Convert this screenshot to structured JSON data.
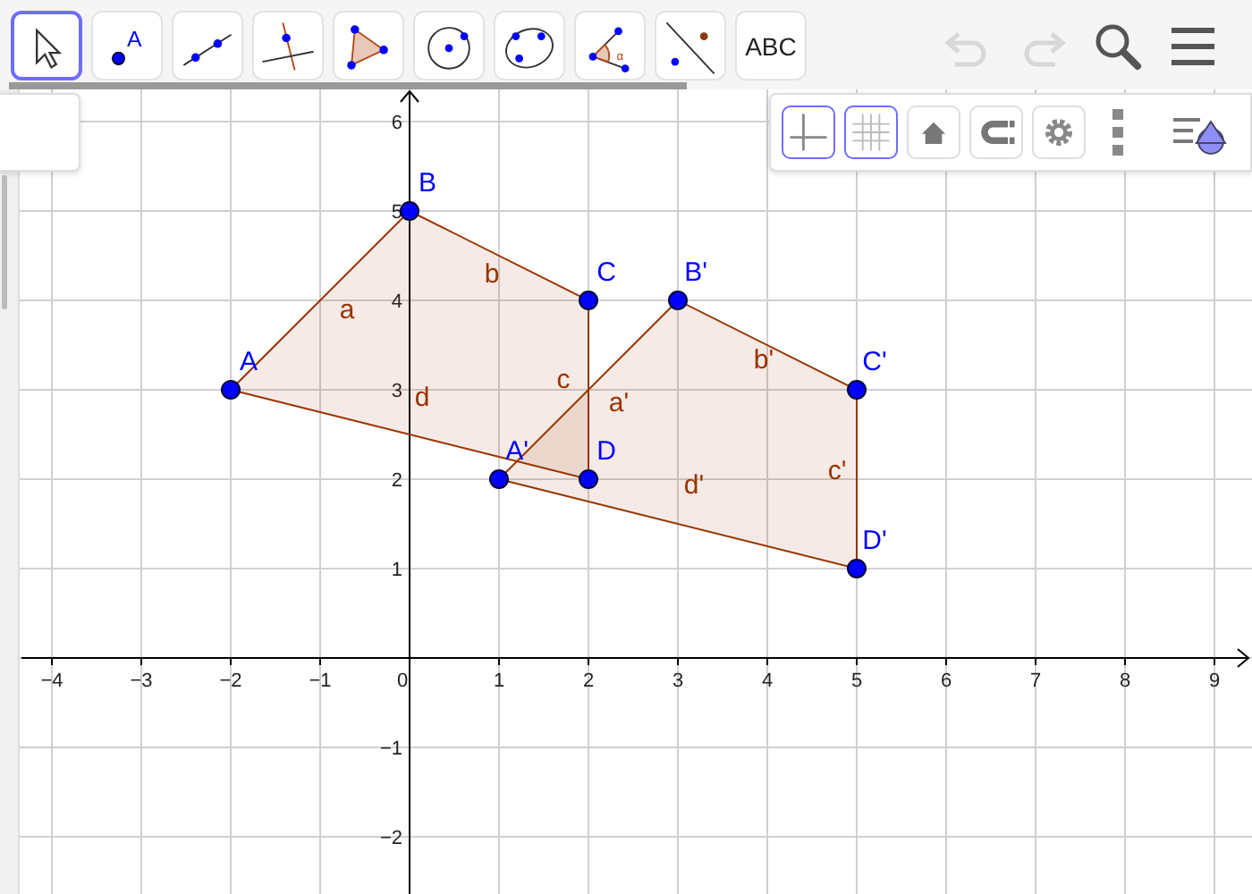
{
  "toolbar": {
    "tools": [
      {
        "kind": "move",
        "selected": true
      },
      {
        "kind": "point",
        "label": "A",
        "selected": false
      },
      {
        "kind": "line",
        "selected": false
      },
      {
        "kind": "perpendicular",
        "selected": false
      },
      {
        "kind": "polygon",
        "selected": false
      },
      {
        "kind": "circle",
        "selected": false
      },
      {
        "kind": "conic",
        "selected": false
      },
      {
        "kind": "angle",
        "label": "α",
        "selected": false
      },
      {
        "kind": "reflect",
        "selected": false
      },
      {
        "kind": "text",
        "label": "ABC",
        "selected": false
      }
    ],
    "actions": [
      {
        "kind": "undo",
        "disabled": true
      },
      {
        "kind": "redo",
        "disabled": true
      },
      {
        "kind": "search",
        "disabled": false
      },
      {
        "kind": "menu",
        "disabled": false
      }
    ]
  },
  "style_bar": {
    "buttons": [
      {
        "kind": "axes",
        "selected": true
      },
      {
        "kind": "grid",
        "selected": true
      },
      {
        "kind": "home"
      },
      {
        "kind": "magnet"
      },
      {
        "kind": "settings"
      },
      {
        "kind": "more"
      },
      {
        "kind": "panel"
      }
    ]
  },
  "graphics": {
    "chart_data": {
      "type": "area",
      "grid": true,
      "xlim": [
        -4.58,
        9.42
      ],
      "ylim": [
        -2.64,
        6.36
      ],
      "xticks": [
        {
          "value": -4,
          "label": "−4"
        },
        {
          "value": -3,
          "label": "−3"
        },
        {
          "value": -2,
          "label": "−2"
        },
        {
          "value": -1,
          "label": "−1"
        },
        {
          "value": 0,
          "label": "0"
        },
        {
          "value": 1,
          "label": "1"
        },
        {
          "value": 2,
          "label": "2"
        },
        {
          "value": 3,
          "label": "3"
        },
        {
          "value": 4,
          "label": "4"
        },
        {
          "value": 5,
          "label": "5"
        },
        {
          "value": 6,
          "label": "6"
        },
        {
          "value": 7,
          "label": "7"
        },
        {
          "value": 8,
          "label": "8"
        },
        {
          "value": 9,
          "label": "9"
        }
      ],
      "yticks": [
        {
          "value": -2,
          "label": "−2"
        },
        {
          "value": -1,
          "label": "−1"
        },
        {
          "value": 1,
          "label": "1"
        },
        {
          "value": 2,
          "label": "2"
        },
        {
          "value": 3,
          "label": "3"
        },
        {
          "value": 4,
          "label": "4"
        },
        {
          "value": 5,
          "label": "5"
        },
        {
          "value": 6,
          "label": "6"
        }
      ],
      "series": [
        {
          "color": "#993300",
          "x": [
            -2,
            0,
            2,
            2,
            -2
          ],
          "values": [
            3,
            5,
            4,
            2,
            3
          ]
        },
        {
          "color": "#993300",
          "x": [
            1,
            3,
            5,
            5,
            1
          ],
          "values": [
            2,
            4,
            3,
            1,
            2
          ]
        }
      ],
      "annotations": [
        {
          "text": "A",
          "x": -2,
          "y": 3
        },
        {
          "text": "B",
          "x": 0,
          "y": 5
        },
        {
          "text": "C",
          "x": 2,
          "y": 4
        },
        {
          "text": "D",
          "x": 2,
          "y": 2
        },
        {
          "text": "A'",
          "x": 1,
          "y": 2
        },
        {
          "text": "B'",
          "x": 3,
          "y": 4
        },
        {
          "text": "C'",
          "x": 5,
          "y": 3
        },
        {
          "text": "D'",
          "x": 5,
          "y": 1
        },
        "a",
        "b",
        "c",
        "d",
        "a'",
        "b'",
        "c'",
        "d'"
      ]
    }
  }
}
